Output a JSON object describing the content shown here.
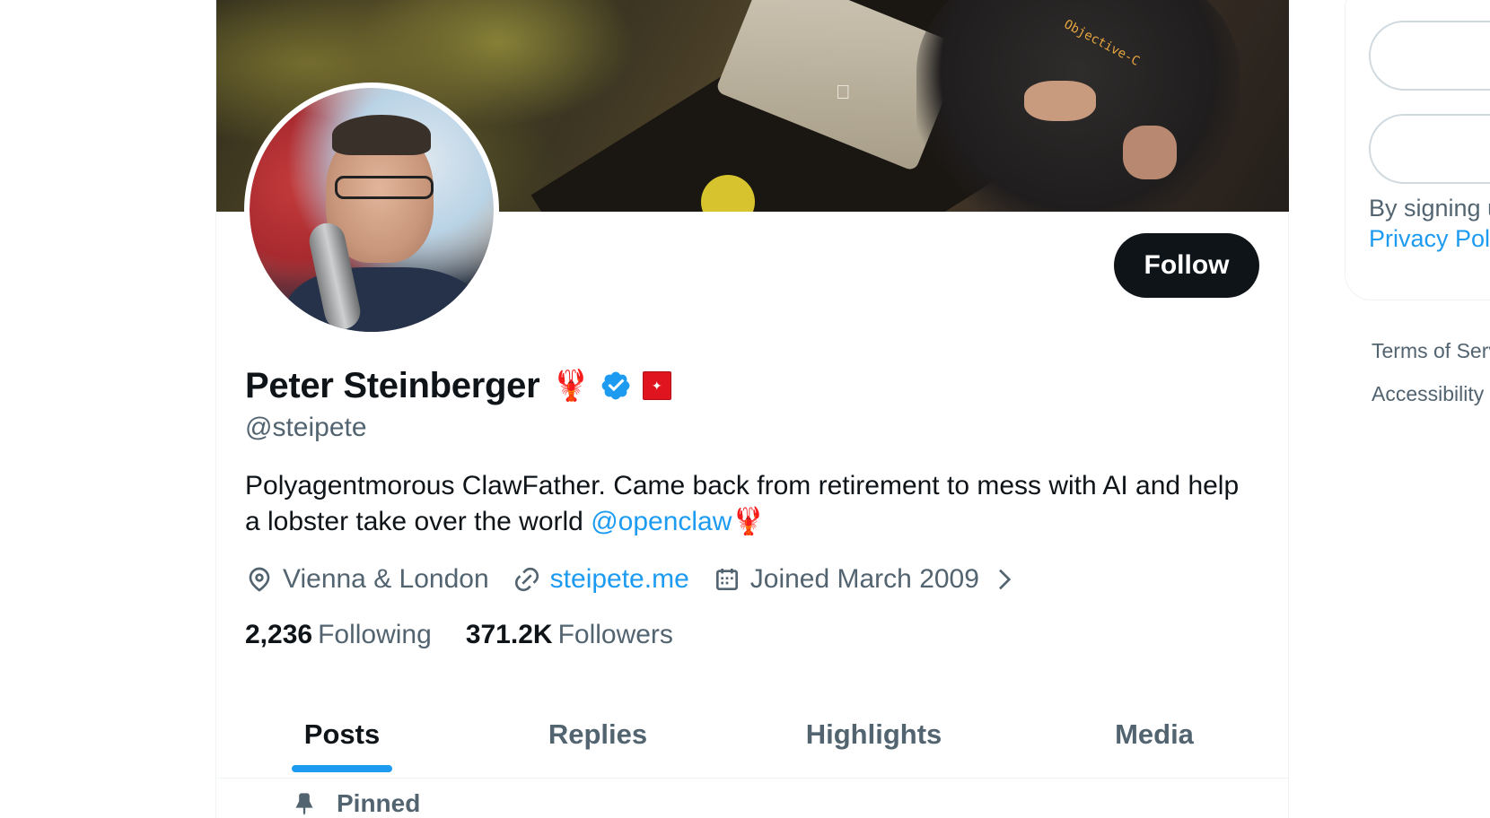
{
  "profile": {
    "display_name": "Peter Steinberger",
    "name_emoji": "🦞",
    "handle": "@steipete",
    "follow_label": "Follow",
    "bio_text": "Polyagentmorous ClawFather. Came back from retirement to mess with AI and help a lobster take over the world ",
    "bio_mention": "@openclaw",
    "bio_emoji": "🦞",
    "location": "Vienna & London",
    "website": "steipete.me",
    "joined": "Joined March 2009",
    "following_count": "2,236",
    "following_label": "Following",
    "followers_count": "371.2K",
    "followers_label": "Followers"
  },
  "banner": {
    "shirt_text": "Objective-C"
  },
  "tabs": [
    {
      "label": "Posts",
      "active": true
    },
    {
      "label": "Replies",
      "active": false
    },
    {
      "label": "Highlights",
      "active": false
    },
    {
      "label": "Media",
      "active": false
    }
  ],
  "pinned_label": "Pinned",
  "sidebar": {
    "signing_text": "By signing u",
    "privacy_text": "Privacy Poli",
    "footer_links": [
      "Terms of Serv",
      "Accessibility"
    ]
  },
  "colors": {
    "accent": "#1d9bf0",
    "text_primary": "#0f1419",
    "text_secondary": "#536471",
    "follow_bg": "#0f1419",
    "border": "#eff3f4"
  },
  "icons": [
    "location-icon",
    "link-icon",
    "calendar-icon",
    "chevron-right-icon",
    "verified-badge-icon",
    "pin-icon",
    "flag-badge-icon"
  ]
}
